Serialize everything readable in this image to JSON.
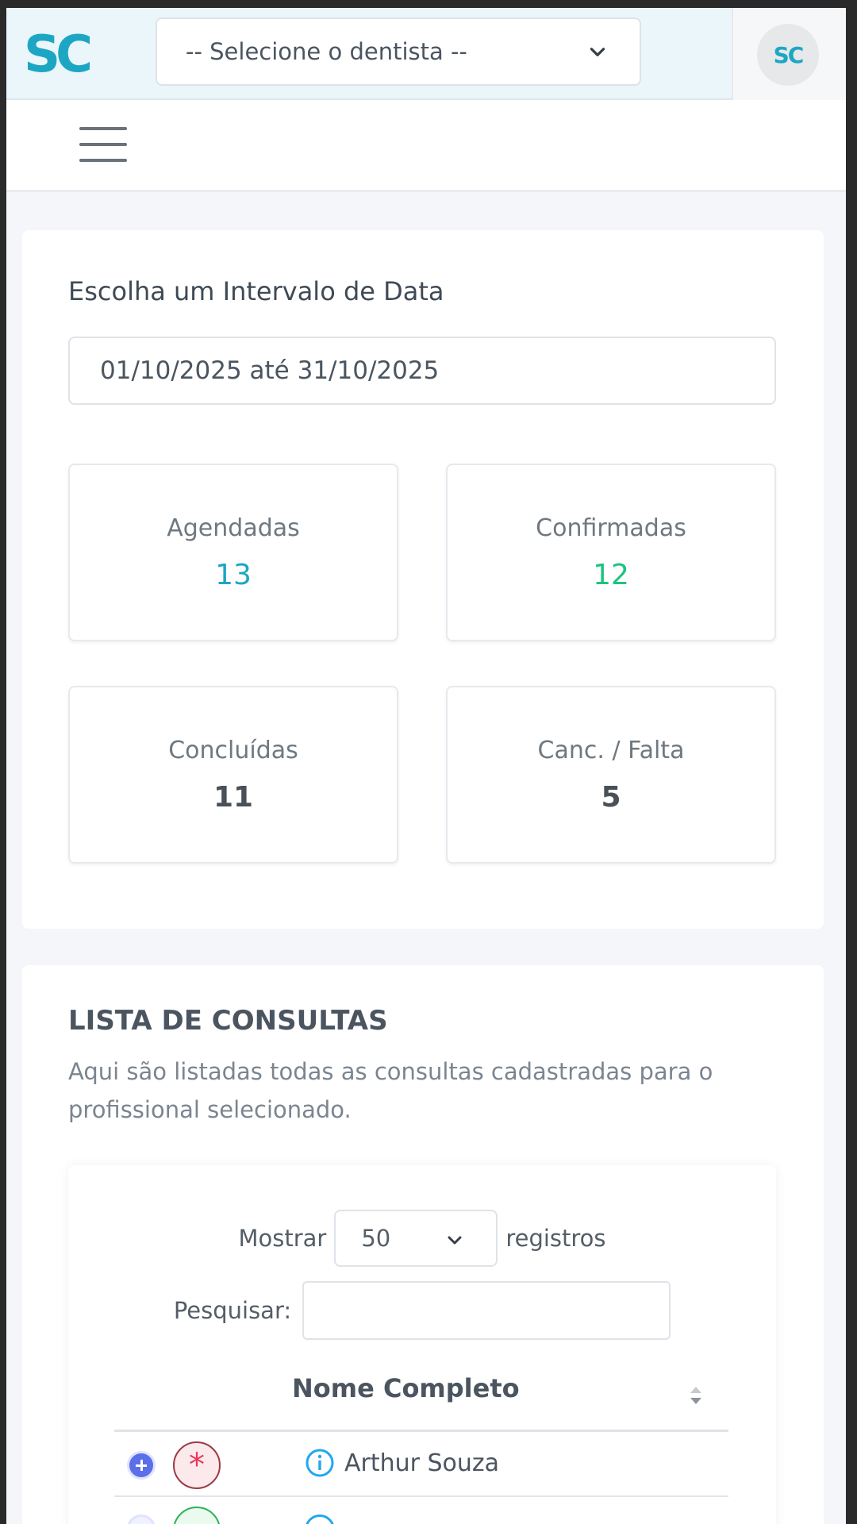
{
  "header": {
    "logo_text": "SC",
    "dentist_select": {
      "value": "-- Selecione o dentista --"
    },
    "avatar_initials": "SC"
  },
  "date_filter": {
    "label": "Escolha um Intervalo de Data",
    "value": "01/10/2025 até 31/10/2025"
  },
  "stats": [
    {
      "label": "Agendadas",
      "value": "13",
      "color": "#1da6c4"
    },
    {
      "label": "Confirmadas",
      "value": "12",
      "color": "#1dc37e"
    },
    {
      "label": "Concluídas",
      "value": "11",
      "color": "#4a5058"
    },
    {
      "label": "Canc. / Falta",
      "value": "5",
      "color": "#4a5058"
    }
  ],
  "list": {
    "title": "LISTA DE CONSULTAS",
    "description": "Aqui são listadas todas as consultas cadastradas para o profissional selecionado.",
    "show_label": "Mostrar",
    "page_length": "50",
    "records_label": "registros",
    "search_label": "Pesquisar:",
    "search_value": "",
    "column_header": "Nome Completo",
    "rows": [
      {
        "name": "Arthur Souza"
      }
    ]
  },
  "colors": {
    "brand": "#1da6c4",
    "success": "#1dc37e",
    "expand": "#5b6fe8",
    "alert": "#e8385a"
  }
}
